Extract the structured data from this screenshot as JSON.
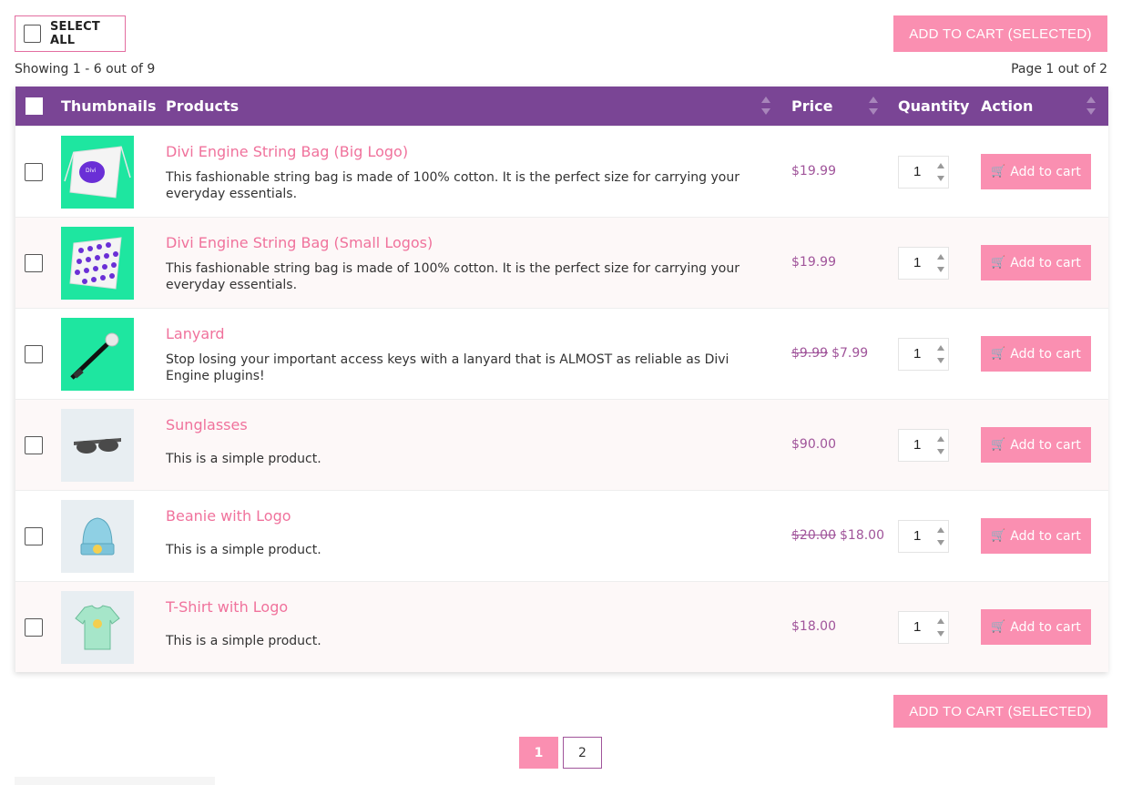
{
  "controls": {
    "select_all_label": "SELECT ALL",
    "add_selected_label": "ADD TO CART (SELECTED)",
    "showing_text": "Showing 1 - 6 out of 9",
    "page_text": "Page 1 out of 2"
  },
  "table": {
    "headers": {
      "thumbnails": "Thumbnails",
      "products": "Products",
      "price": "Price",
      "quantity": "Quantity",
      "action": "Action"
    },
    "rows": [
      {
        "name": "Divi Engine String Bag (Big Logo)",
        "description": "This fashionable string bag is made of 100% cotton. It is the perfect size for carrying your everyday essentials.",
        "old_price": "",
        "price": "$19.99",
        "quantity": "1",
        "action_label": "Add to cart",
        "thumbnail": "string-bag-big-logo"
      },
      {
        "name": "Divi Engine String Bag (Small Logos)",
        "description": "This fashionable string bag is made of 100% cotton. It is the perfect size for carrying your everyday essentials.",
        "old_price": "",
        "price": "$19.99",
        "quantity": "1",
        "action_label": "Add to cart",
        "thumbnail": "string-bag-small-logos"
      },
      {
        "name": "Lanyard",
        "description": "Stop losing your important access keys with a lanyard that is ALMOST as reliable as Divi Engine plugins!",
        "old_price": "$9.99",
        "price": "$7.99",
        "quantity": "1",
        "action_label": "Add to cart",
        "thumbnail": "lanyard"
      },
      {
        "name": "Sunglasses",
        "description": "This is a simple product.",
        "old_price": "",
        "price": "$90.00",
        "quantity": "1",
        "action_label": "Add to cart",
        "thumbnail": "sunglasses"
      },
      {
        "name": "Beanie with Logo",
        "description": "This is a simple product.",
        "old_price": "$20.00",
        "price": "$18.00",
        "quantity": "1",
        "action_label": "Add to cart",
        "thumbnail": "beanie"
      },
      {
        "name": "T-Shirt with Logo",
        "description": "This is a simple product.",
        "old_price": "",
        "price": "$18.00",
        "quantity": "1",
        "action_label": "Add to cart",
        "thumbnail": "tshirt"
      }
    ]
  },
  "pagination": {
    "pages": [
      "1",
      "2"
    ],
    "current": "1"
  },
  "colors": {
    "header_bg": "#7a4595",
    "accent_pink": "#fa8fb1",
    "link_pink": "#f0729c",
    "price_purple": "#a0549a",
    "thumb_green": "#1ee6a0",
    "thumb_grey": "#e8eef2"
  },
  "icons": {
    "cart": "cart-icon",
    "sort": "sort-icon"
  }
}
